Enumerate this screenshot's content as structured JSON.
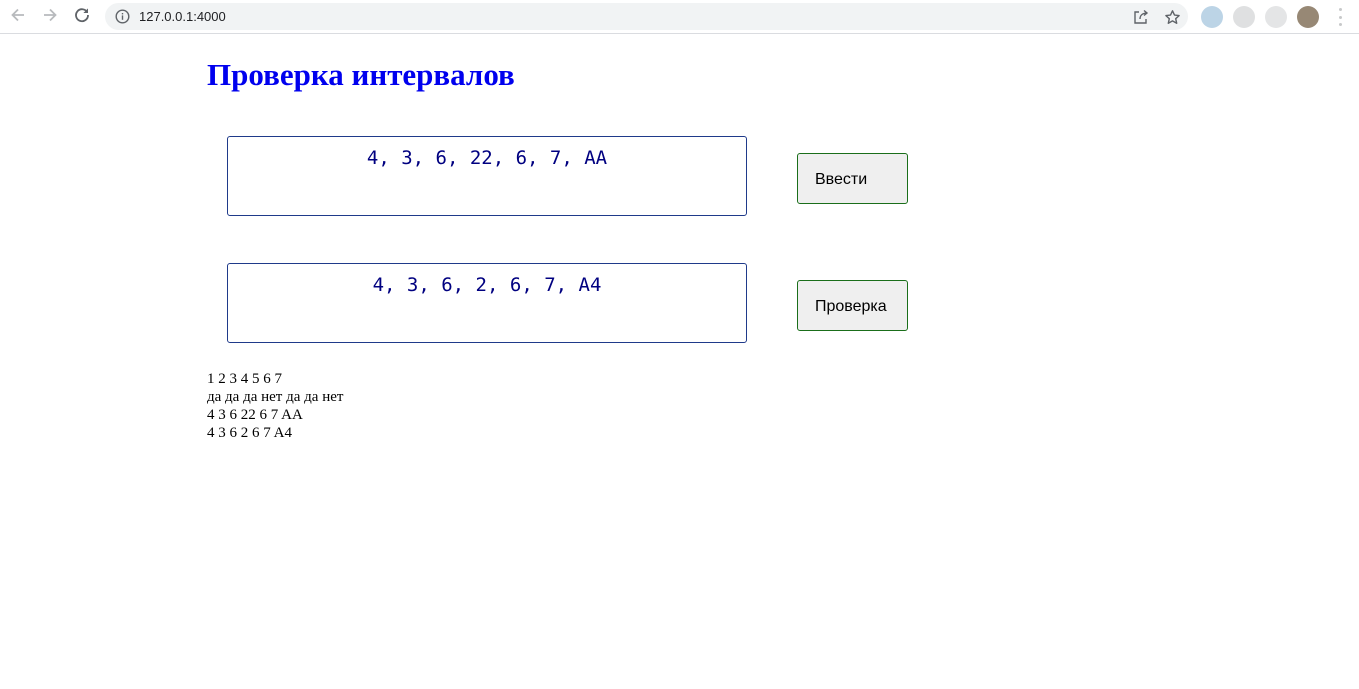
{
  "browser": {
    "url": "127.0.0.1:4000",
    "icons": [
      "back-icon",
      "forward-icon",
      "reload-icon",
      "info-icon",
      "share-icon",
      "star-icon",
      "menu-icon"
    ]
  },
  "page": {
    "title": "Проверка интервалов",
    "input1": {
      "value": "4, 3, 6, 22, 6, 7, AA"
    },
    "input2": {
      "value": "4, 3, 6, 2, 6, 7, A4"
    },
    "enter_button": "Ввести",
    "check_button": "Проверка",
    "output": {
      "line1": "1 2 3 4 5 6 7",
      "line2": "да да да нет да да нет",
      "line3": "4 3 6 22 6 7 AA",
      "line4": "4 3 6 2 6 7 A4"
    }
  },
  "colors": {
    "title": "#0000ee",
    "field_text": "#000080",
    "field_border": "#1f3a8a",
    "button_border": "#1a6e1a",
    "button_bg": "#efefef"
  }
}
